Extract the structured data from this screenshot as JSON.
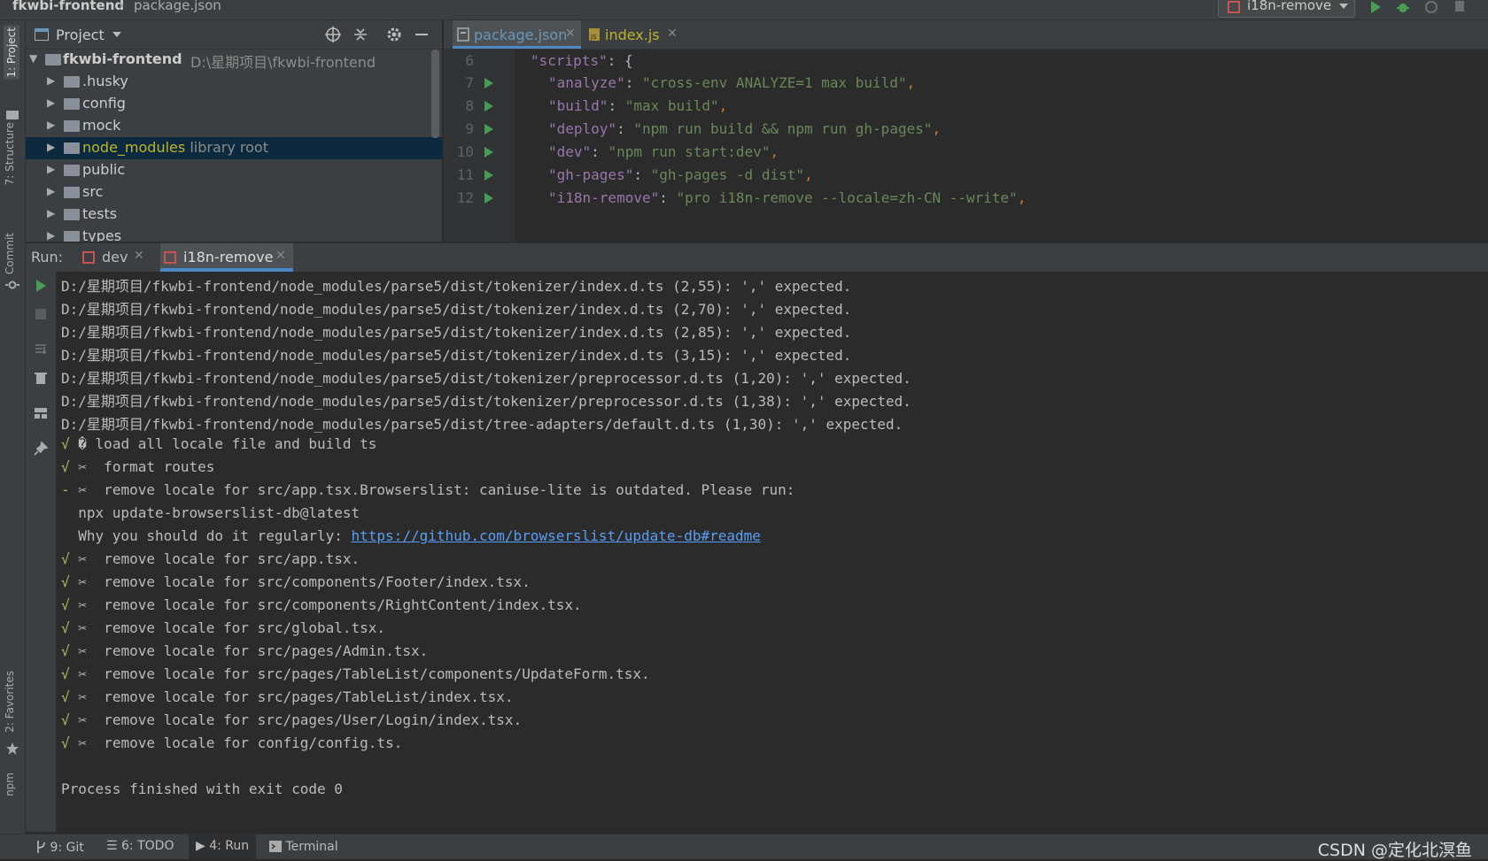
{
  "breadcrumb": {
    "project": "fkwbi-frontend",
    "separator": "›",
    "file": "package.json"
  },
  "run_config": {
    "label": "i18n-remove"
  },
  "left_strip": {
    "project": "1: Project",
    "structure": "7: Structure",
    "commit": "Commit",
    "favorites": "2: Favorites",
    "npm": "npm"
  },
  "project_panel": {
    "title": "Project",
    "root": {
      "name": "fkwbi-frontend",
      "path": "D:\\星期项目\\fkwbi-frontend"
    },
    "items": [
      {
        "label": ".husky",
        "hint": ""
      },
      {
        "label": "config",
        "hint": ""
      },
      {
        "label": "mock",
        "hint": ""
      },
      {
        "label": "node_modules",
        "hint": "library root"
      },
      {
        "label": "public",
        "hint": ""
      },
      {
        "label": "src",
        "hint": ""
      },
      {
        "label": "tests",
        "hint": ""
      },
      {
        "label": "types",
        "hint": ""
      }
    ]
  },
  "editor": {
    "tabs": [
      {
        "label": "package.json",
        "active": true
      },
      {
        "label": "index.js",
        "active": false
      }
    ],
    "lines": [
      {
        "num": "6",
        "key": "\"scripts\"",
        "value": "{",
        "runnable": false
      },
      {
        "num": "7",
        "key": "\"analyze\"",
        "value": "\"cross-env ANALYZE=1 max build\"",
        "runnable": true
      },
      {
        "num": "8",
        "key": "\"build\"",
        "value": "\"max build\"",
        "runnable": true
      },
      {
        "num": "9",
        "key": "\"deploy\"",
        "value": "\"npm run build && npm run gh-pages\"",
        "runnable": true
      },
      {
        "num": "10",
        "key": "\"dev\"",
        "value": "\"npm run start:dev\"",
        "runnable": true
      },
      {
        "num": "11",
        "key": "\"gh-pages\"",
        "value": "\"gh-pages -d dist\"",
        "runnable": true
      },
      {
        "num": "12",
        "key": "\"i18n-remove\"",
        "value": "\"pro i18n-remove --locale=zh-CN --write\"",
        "runnable": true
      }
    ]
  },
  "run_panel": {
    "label": "Run:",
    "tabs": [
      {
        "label": "dev",
        "active": false
      },
      {
        "label": "i18n-remove",
        "active": true
      }
    ]
  },
  "console": {
    "lines": [
      {
        "mark": "",
        "text": "D:/星期项目/fkwbi-frontend/node_modules/parse5/dist/tokenizer/index.d.ts (2,55): ',' expected."
      },
      {
        "mark": "",
        "text": "D:/星期项目/fkwbi-frontend/node_modules/parse5/dist/tokenizer/index.d.ts (2,70): ',' expected."
      },
      {
        "mark": "",
        "text": "D:/星期项目/fkwbi-frontend/node_modules/parse5/dist/tokenizer/index.d.ts (2,85): ',' expected."
      },
      {
        "mark": "",
        "text": "D:/星期项目/fkwbi-frontend/node_modules/parse5/dist/tokenizer/index.d.ts (3,15): ',' expected."
      },
      {
        "mark": "",
        "text": "D:/星期项目/fkwbi-frontend/node_modules/parse5/dist/tokenizer/preprocessor.d.ts (1,20): ',' expected."
      },
      {
        "mark": "",
        "text": "D:/星期项目/fkwbi-frontend/node_modules/parse5/dist/tokenizer/preprocessor.d.ts (1,38): ',' expected."
      },
      {
        "mark": "",
        "text": "D:/星期项目/fkwbi-frontend/node_modules/parse5/dist/tree-adapters/default.d.ts (1,30): ',' expected."
      },
      {
        "mark": "√",
        "text": "� load all locale file and build ts"
      },
      {
        "mark": "√",
        "text": "✂  format routes"
      },
      {
        "mark": "-",
        "text": "✂  remove locale for src/app.tsx.Browserslist: caniuse-lite is outdated. Please run:"
      },
      {
        "mark": "",
        "text": "  npx update-browserslist-db@latest"
      },
      {
        "mark": "",
        "text": "  Why you should do it regularly: ",
        "link": "https://github.com/browserslist/update-db#readme"
      },
      {
        "mark": "√",
        "text": "✂  remove locale for src/app.tsx."
      },
      {
        "mark": "√",
        "text": "✂  remove locale for src/components/Footer/index.tsx."
      },
      {
        "mark": "√",
        "text": "✂  remove locale for src/components/RightContent/index.tsx."
      },
      {
        "mark": "√",
        "text": "✂  remove locale for src/global.tsx."
      },
      {
        "mark": "√",
        "text": "✂  remove locale for src/pages/Admin.tsx."
      },
      {
        "mark": "√",
        "text": "✂  remove locale for src/pages/TableList/components/UpdateForm.tsx."
      },
      {
        "mark": "√",
        "text": "✂  remove locale for src/pages/TableList/index.tsx."
      },
      {
        "mark": "√",
        "text": "✂  remove locale for src/pages/User/Login/index.tsx."
      },
      {
        "mark": "√",
        "text": "✂  remove locale for config/config.ts."
      },
      {
        "mark": "",
        "text": ""
      },
      {
        "mark": "",
        "text": "Process finished with exit code 0"
      }
    ]
  },
  "statusbar": {
    "git": "9: Git",
    "todo": "6: TODO",
    "run": "4: Run",
    "terminal": "Terminal",
    "watermark": "CSDN @定化北溟鱼"
  },
  "colors": {
    "accent_green": "#499c54",
    "link": "#589df6",
    "selection": "#0d293e"
  }
}
